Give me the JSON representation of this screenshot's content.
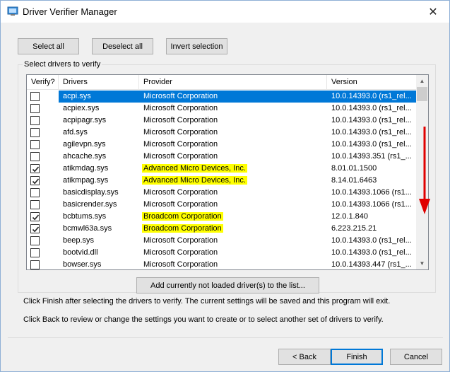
{
  "window": {
    "title": "Driver Verifier Manager"
  },
  "buttons": {
    "select_all": "Select all",
    "deselect_all": "Deselect all",
    "invert_selection": "Invert selection",
    "add_not_loaded": "Add currently not loaded driver(s) to the list...",
    "back": "< Back",
    "finish": "Finish",
    "cancel": "Cancel"
  },
  "group": {
    "label": "Select drivers to verify"
  },
  "columns": {
    "verify": "Verify?",
    "drivers": "Drivers",
    "provider": "Provider",
    "version": "Version"
  },
  "rows": [
    {
      "checked": false,
      "driver": "acpi.sys",
      "provider": "Microsoft Corporation",
      "version": "10.0.14393.0 (rs1_rel...",
      "selected": true,
      "highlight": false
    },
    {
      "checked": false,
      "driver": "acpiex.sys",
      "provider": "Microsoft Corporation",
      "version": "10.0.14393.0 (rs1_rel...",
      "selected": false,
      "highlight": false
    },
    {
      "checked": false,
      "driver": "acpipagr.sys",
      "provider": "Microsoft Corporation",
      "version": "10.0.14393.0 (rs1_rel...",
      "selected": false,
      "highlight": false
    },
    {
      "checked": false,
      "driver": "afd.sys",
      "provider": "Microsoft Corporation",
      "version": "10.0.14393.0 (rs1_rel...",
      "selected": false,
      "highlight": false
    },
    {
      "checked": false,
      "driver": "agilevpn.sys",
      "provider": "Microsoft Corporation",
      "version": "10.0.14393.0 (rs1_rel...",
      "selected": false,
      "highlight": false
    },
    {
      "checked": false,
      "driver": "ahcache.sys",
      "provider": "Microsoft Corporation",
      "version": "10.0.14393.351 (rs1_...",
      "selected": false,
      "highlight": false
    },
    {
      "checked": true,
      "driver": "atikmdag.sys",
      "provider": "Advanced Micro Devices, Inc.",
      "version": "8.01.01.1500",
      "selected": false,
      "highlight": true
    },
    {
      "checked": true,
      "driver": "atikmpag.sys",
      "provider": "Advanced Micro Devices, Inc.",
      "version": "8.14.01.6463",
      "selected": false,
      "highlight": true
    },
    {
      "checked": false,
      "driver": "basicdisplay.sys",
      "provider": "Microsoft Corporation",
      "version": "10.0.14393.1066 (rs1...",
      "selected": false,
      "highlight": false
    },
    {
      "checked": false,
      "driver": "basicrender.sys",
      "provider": "Microsoft Corporation",
      "version": "10.0.14393.1066 (rs1...",
      "selected": false,
      "highlight": false
    },
    {
      "checked": true,
      "driver": "bcbtums.sys",
      "provider": "Broadcom Corporation",
      "version": "12.0.1.840",
      "selected": false,
      "highlight": true
    },
    {
      "checked": true,
      "driver": "bcmwl63a.sys",
      "provider": "Broadcom Corporation",
      "version": "6.223.215.21",
      "selected": false,
      "highlight": true
    },
    {
      "checked": false,
      "driver": "beep.sys",
      "provider": "Microsoft Corporation",
      "version": "10.0.14393.0 (rs1_rel...",
      "selected": false,
      "highlight": false
    },
    {
      "checked": false,
      "driver": "bootvid.dll",
      "provider": "Microsoft Corporation",
      "version": "10.0.14393.0 (rs1_rel...",
      "selected": false,
      "highlight": false
    },
    {
      "checked": false,
      "driver": "bowser.sys",
      "provider": "Microsoft Corporation",
      "version": "10.0.14393.447 (rs1_...",
      "selected": false,
      "highlight": false
    }
  ],
  "info": {
    "finish_text": "Click Finish after selecting the drivers to verify. The current settings will be saved and this program will exit.",
    "back_text": "Click Back to review or change the settings you want to create or to select another set of drivers to verify."
  },
  "colors": {
    "selection": "#0078d7",
    "highlight": "#ffff00",
    "annotation_arrow": "#e00000"
  },
  "icons": {
    "window_icon": "driver-verifier-icon",
    "close": "close-icon",
    "scroll_up": "chevron-up-icon",
    "scroll_down": "chevron-down-icon",
    "checkmark": "check-icon",
    "annotation": "red-arrow-down-icon"
  }
}
